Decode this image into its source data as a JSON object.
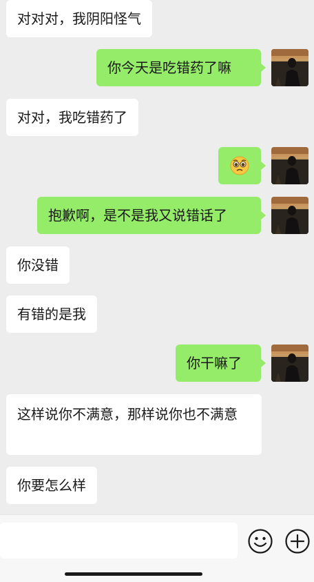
{
  "chat": {
    "messages": [
      {
        "side": "in",
        "text": "对对对，我阴阳怪气"
      },
      {
        "side": "out",
        "text": "你今天是吃错药了嘛"
      },
      {
        "side": "in",
        "text": "对对，我吃错药了"
      },
      {
        "side": "out",
        "emoji": "pleading-face-icon"
      },
      {
        "side": "out",
        "text": "抱歉啊，是不是我又说错话了"
      },
      {
        "side": "in",
        "text": "你没错"
      },
      {
        "side": "in",
        "text": "有错的是我"
      },
      {
        "side": "out",
        "text": "你干嘛了"
      },
      {
        "side": "in",
        "text": "这样说你不满意，那样说你也不满意"
      },
      {
        "side": "in",
        "text": "你要怎么样"
      }
    ]
  },
  "input_bar": {
    "value": "",
    "emoji_icon": "smiley-face-icon",
    "add_icon": "plus-circle-icon"
  },
  "colors": {
    "background": "#ededed",
    "outgoing_bubble": "#95ec69",
    "incoming_bubble": "#ffffff",
    "text": "#191919"
  }
}
